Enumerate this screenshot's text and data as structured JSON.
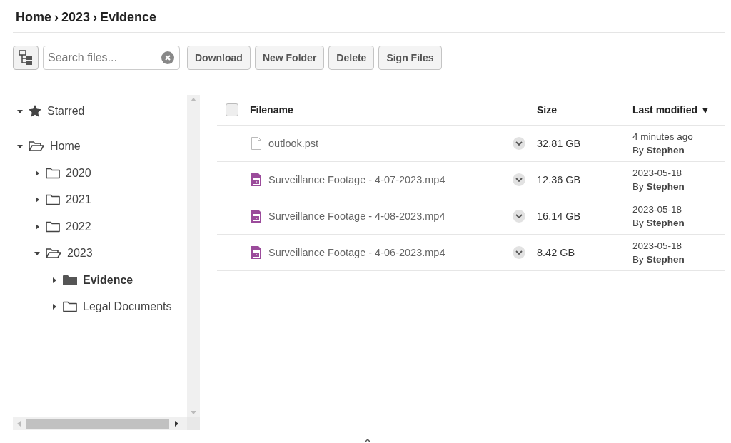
{
  "breadcrumb": {
    "items": [
      "Home",
      "2023",
      "Evidence"
    ],
    "separator": "›"
  },
  "toolbar": {
    "search": {
      "placeholder": "Search files..."
    },
    "buttons": [
      "Download",
      "New Folder",
      "Delete",
      "Sign Files"
    ]
  },
  "tree": [
    {
      "label": "Starred",
      "kind": "starred",
      "expanded": true,
      "selected": false
    },
    {
      "label": "Home",
      "kind": "folder",
      "expanded": true,
      "selected": false,
      "children": [
        {
          "label": "2020",
          "kind": "folder",
          "expanded": false,
          "selected": false
        },
        {
          "label": "2021",
          "kind": "folder",
          "expanded": false,
          "selected": false
        },
        {
          "label": "2022",
          "kind": "folder",
          "expanded": false,
          "selected": false
        },
        {
          "label": "2023",
          "kind": "folder",
          "expanded": true,
          "selected": false,
          "children": [
            {
              "label": "Evidence",
              "kind": "folder",
              "expanded": false,
              "selected": true
            },
            {
              "label": "Legal Documents",
              "kind": "folder",
              "expanded": false,
              "selected": false
            }
          ]
        }
      ]
    }
  ],
  "table": {
    "select_all": {
      "checked": false
    },
    "columns": [
      "Filename",
      "Size",
      "Last modified ▼"
    ],
    "rows": [
      {
        "name": "outlook.pst",
        "kind": "file",
        "size": "32.81 GB",
        "modified": "4 minutes ago",
        "by": "By **Stephen**"
      },
      {
        "name": "Surveillance Footage - 4-07-2023.mp4",
        "kind": "video",
        "size": "12.36 GB",
        "modified": "2023-05-18",
        "by": "By **Stephen**"
      },
      {
        "name": "Surveillance Footage - 4-08-2023.mp4",
        "kind": "video",
        "size": "16.14 GB",
        "modified": "2023-05-18",
        "by": "By **Stephen**"
      },
      {
        "name": "Surveillance Footage - 4-06-2023.mp4",
        "kind": "video",
        "size": "8.42 GB",
        "modified": "2023-05-18",
        "by": "By **Stephen**"
      }
    ]
  }
}
